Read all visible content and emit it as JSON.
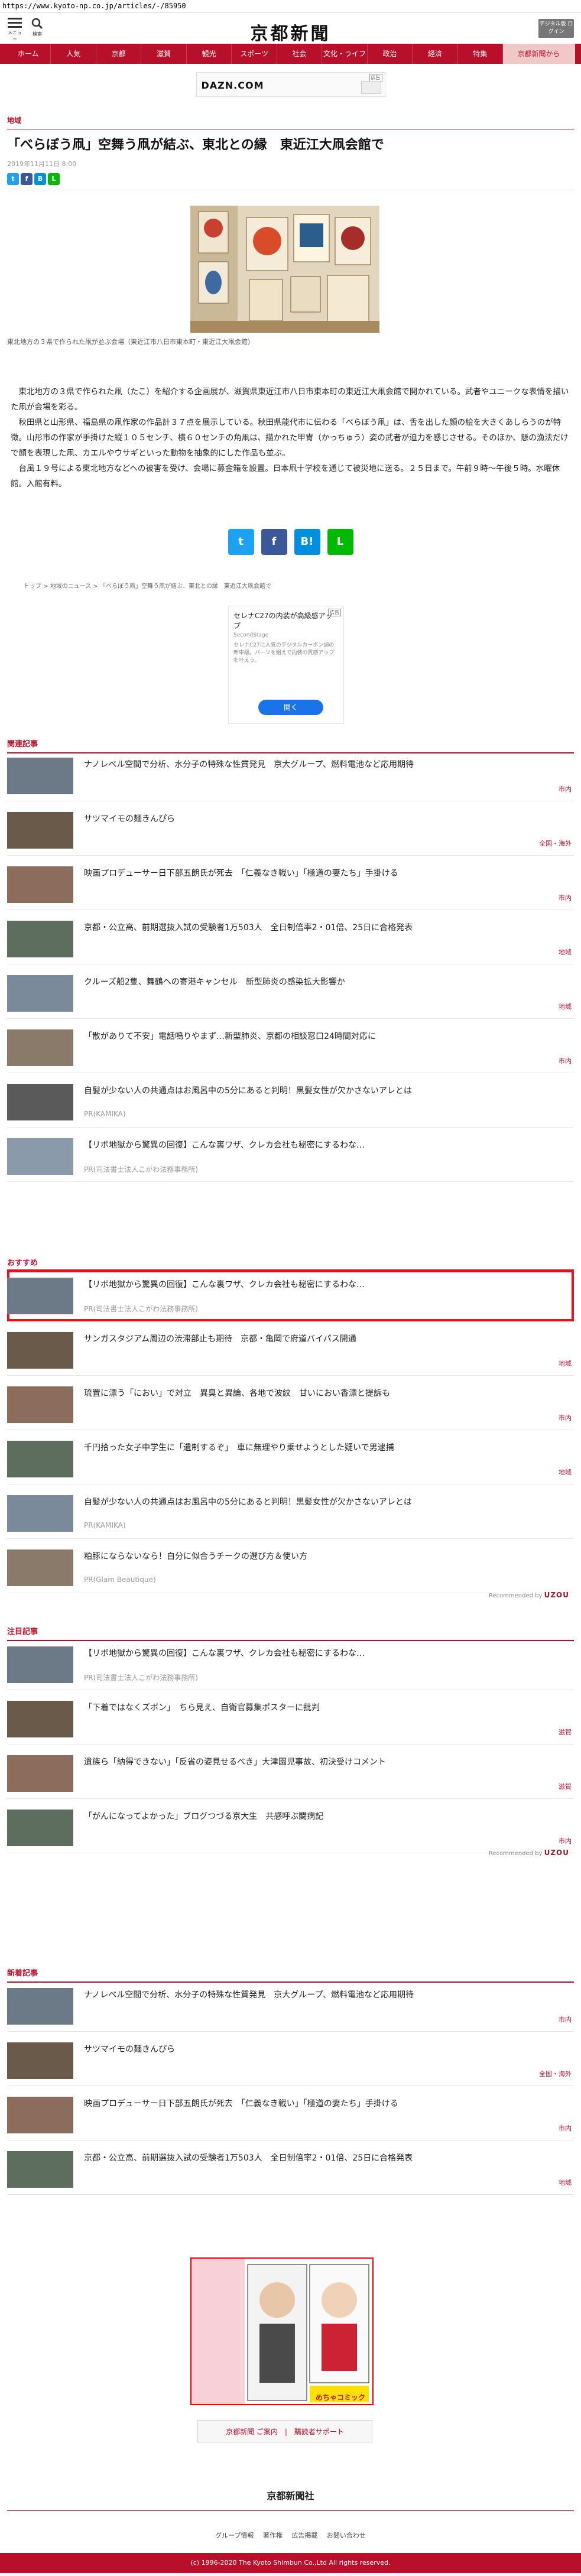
{
  "url": "https://www.kyoto-np.co.jp/articles/-/85950",
  "header": {
    "menu_label": "メニュー",
    "search_label": "検索",
    "logo": "京都新聞",
    "digital_label": "デジタル版 ログイン"
  },
  "nav": [
    "ホーム",
    "人気",
    "京都",
    "滋賀",
    "観光",
    "スポーツ",
    "社会",
    "文化・ライフ",
    "政治",
    "経済",
    "特集",
    "京都新聞から"
  ],
  "ad_top": {
    "brand": "DAZN.COM",
    "badge": "広告"
  },
  "article": {
    "section": "地域",
    "title": "「べらぼう凧」空舞う凧が結ぶ、東北との縁　東近江大凧会館で",
    "date": "2019年11月11日 8:00",
    "caption": "東北地方の３県で作られた凧が並ぶ会場（東近江市八日市東本町・東近江大凧会館）",
    "body": "　東北地方の３県で作られた凧（たこ）を紹介する企画展が、滋賀県東近江市八日市東本町の東近江大凧会館で開かれている。武者やユニークな表情を描いた凧が会場を彩る。\n　秋田県と山形県、福島県の凧作家の作品計３７点を展示している。秋田県能代市に伝わる「べらぼう凧」は、舌を出した顔の絵を大きくあしらうのが特徴。山形市の作家が手掛けた縦１０５センチ、横６０センチの角凧は、描かれた甲冑（かっちゅう）姿の武者が迫力を感じさせる。そのほか、懸の漁法だけで顔を表現した凧、カエルやウサギといった動物を抽象的にした作品も並ぶ。\n　台風１９号による東北地方などへの被害を受け、会場に募金箱を設置。日本凧十学校を通じて被災地に送る。２５日まで。午前９時～午後５時。水曜休館。入館有料。",
    "breadcrumb": [
      "トップ",
      "地域のニュース",
      "「べらぼう凧」空舞う凧が結ぶ、東北との縁　東近江大凧会館で"
    ]
  },
  "ad_mid": {
    "badge": "広告",
    "title": "セレナC27の内装が高級感アップ",
    "source": "SecondStage",
    "desc": "セレナC27に人気のデジタルカーボン調の新車級。パーツを組えで内装の質感アップを叶えう。",
    "button": "開く"
  },
  "related": {
    "label": "関連記事",
    "items": [
      {
        "title": "ナノレベル空間で分析、水分子の特殊な性質発見　京大グループ、燃料電池など応用期待",
        "cat": "市内"
      },
      {
        "title": "サツマイモの麺きんぴら",
        "cat": "全国・海外"
      },
      {
        "title": "映画プロデューサー日下部五朗氏が死去　「仁義なき戦い」「極道の妻たち」手掛ける",
        "cat": "市内"
      },
      {
        "title": "京都・公立高、前期選抜入試の受験者1万503人　全日制倍率2・01倍、25日に合格発表",
        "cat": "地域"
      },
      {
        "title": "クルーズ船2隻、舞鶴への寄港キャンセル　新型肺炎の感染拡大影響か",
        "cat": "地域"
      },
      {
        "title": "「散がありて不安」電話鳴りやまず…新型肺炎、京都の相談窓口24時間対応に",
        "cat": "市内"
      },
      {
        "title": "自髪が少ない人の共通点はお風呂中の5分にあると判明！黒髪女性が欠かさないアレとは",
        "pr": "PR(KAMIKA)"
      },
      {
        "title": "【リボ地獄から驚異の回復】こんな裏ワザ、クレカ会社も秘密にするわな…",
        "pr": "PR(司法書士法人こがわ法務事務所)"
      }
    ]
  },
  "recommend": {
    "label": "おすすめ",
    "items": [
      {
        "title": "【リボ地獄から驚異の回復】こんな裏ワザ、クレカ会社も秘密にするわな…",
        "pr": "PR(司法書士法人こがわ法務事務所)"
      },
      {
        "title": "サンガスタジアム周辺の渋滞部止も期待　京都・亀岡で府道バイパス開通",
        "cat": "地域"
      },
      {
        "title": "琉置に漂う「におい」で対立　異臭と異論、各地で波紋　甘いにおい香漂と提訴も",
        "cat": "市内"
      },
      {
        "title": "千円拾った女子中学生に「遺制するぞ」　車に無理やり乗せようとした疑いで男逮捕",
        "cat": "地域"
      },
      {
        "title": "自髪が少ない人の共通点はお風呂中の5分にあると判明！黒髪女性が欠かさないアレとは",
        "pr": "PR(KAMIKA)"
      },
      {
        "title": "粕豚にならないなら！自分に似合うチークの選び方＆使い方",
        "pr": "PR(Glam Beautique)"
      }
    ],
    "by_prefix": "Recommended by",
    "by_brand": "UZOU"
  },
  "attention": {
    "label": "注目記事",
    "items": [
      {
        "title": "【リボ地獄から驚異の回復】こんな裏ワザ、クレカ会社も秘密にするわな…",
        "pr": "PR(司法書士法人こがわ法務事務所)"
      },
      {
        "title": "「下着ではなくズボン」　ちら見え、自衛官募集ポスターに批判",
        "cat": "滋賀"
      },
      {
        "title": "遺族ら「納得できない」「反省の姿見せるべき」大津園児事故、初決受けコメント",
        "cat": "滋賀"
      },
      {
        "title": "「がんになってよかった」ブログつづる京大生　共感呼ぶ闘病記",
        "cat": "市内"
      }
    ],
    "by_prefix": "Recommended by",
    "by_brand": "UZOU"
  },
  "latest": {
    "label": "新着記事",
    "items": [
      {
        "title": "ナノレベル空間で分析、水分子の特殊な性質発見　京大グループ、燃料電池など応用期待",
        "cat": "市内"
      },
      {
        "title": "サツマイモの麺きんぴら",
        "cat": "全国・海外"
      },
      {
        "title": "映画プロデューサー日下部五朗氏が死去　「仁義なき戦い」「極道の妻たち」手掛ける",
        "cat": "市内"
      },
      {
        "title": "京都・公立高、前期選抜入試の受験者1万503人　全日制倍率2・01倍、25日に合格発表",
        "cat": "地域"
      }
    ]
  },
  "ad_bottom": {
    "label": "めちゃコミック"
  },
  "footer": {
    "button": "京都新聞 ご案内　|　購読者サポート",
    "logo": "京都新聞社",
    "links": [
      "グループ情報",
      "著作権",
      "広告掲載",
      "お問い合わせ"
    ],
    "copyright": "(c) 1996-2020 The Kyoto Shimbun Co.,Ltd All rights reserved."
  },
  "colors": {
    "brand": "#b8102a",
    "highlight": "#e8141d",
    "twitter": "#1da1f2",
    "facebook": "#3b5998",
    "hatena": "#008fde",
    "line": "#00b900"
  }
}
